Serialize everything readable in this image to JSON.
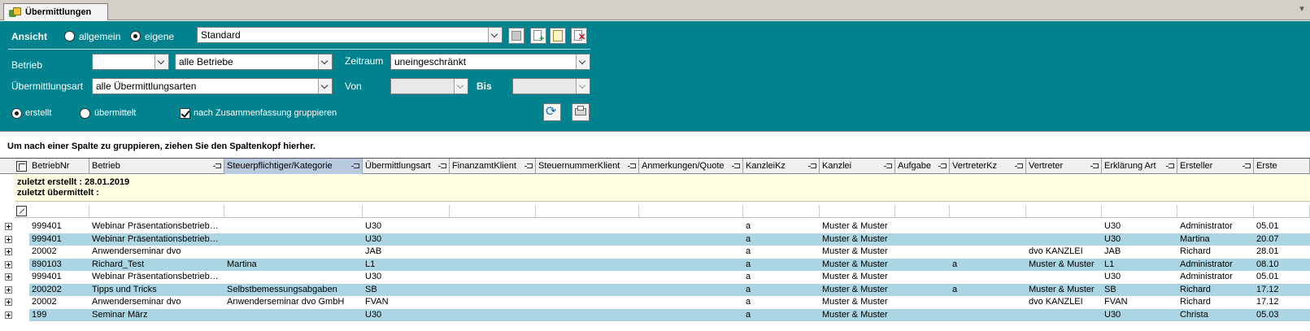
{
  "tab": {
    "title": "Übermittlungen",
    "icon": "transmission-icon"
  },
  "ansicht": {
    "label": "Ansicht",
    "option_allgemein": "allgemein",
    "option_eigene": "eigene",
    "selected": "eigene",
    "view_value": "Standard"
  },
  "betrieb": {
    "label": "Betrieb",
    "code_value": "",
    "value": "alle Betriebe"
  },
  "zeitraum": {
    "label": "Zeitraum",
    "value": "uneingeschränkt"
  },
  "uebermittlungsart": {
    "label": "Übermittlungsart",
    "value": "alle Übermittlungsarten"
  },
  "von": {
    "label": "Von",
    "value": ""
  },
  "bis": {
    "label": "Bis",
    "value": ""
  },
  "status": {
    "option_erstellt": "erstellt",
    "option_uebermittelt": "übermittelt",
    "selected": "erstellt"
  },
  "gruppieren": {
    "label": "nach Zusammenfassung gruppieren",
    "checked": true
  },
  "group_hint": "Um nach einer Spalte zu gruppieren, ziehen Sie den Spaltenkopf hierher.",
  "grid": {
    "columns": [
      "BetriebNr",
      "Betrieb",
      "Steuerpflichtiger/Kategorie",
      "Übermittlungsart",
      "FinanzamtKlient",
      "SteuernummerKlient",
      "Anmerkungen/Quote",
      "KanzleiKz",
      "Kanzlei",
      "Aufgabe",
      "VertreterKz",
      "Vertreter",
      "Erklärung Art",
      "Ersteller",
      "Erste"
    ],
    "selected_column": "Steuerpflichtiger/Kategorie",
    "summary_line1": "zuletzt erstellt : 28.01.2019",
    "summary_line2": "zuletzt übermittelt :",
    "rows": [
      [
        "999401",
        "Webinar  Präsentationsbetrieb…",
        "",
        "U30",
        "",
        "",
        "",
        "a",
        "Muster & Muster",
        "",
        "",
        "",
        "U30",
        "Administrator",
        "05.01"
      ],
      [
        "999401",
        "Webinar  Präsentationsbetrieb…",
        "",
        "U30",
        "",
        "",
        "",
        "a",
        "Muster & Muster",
        "",
        "",
        "",
        "U30",
        "Martina",
        "20.07"
      ],
      [
        "20002",
        "Anwenderseminar dvo",
        "",
        "JAB",
        "",
        "",
        "",
        "a",
        "Muster & Muster",
        "",
        "",
        "dvo KANZLEI",
        "JAB",
        "Richard",
        "28.01"
      ],
      [
        "890103",
        "Richard_Test",
        "Martina",
        "L1",
        "",
        "",
        "",
        "a",
        "Muster & Muster",
        "",
        "a",
        "Muster & Muster",
        "L1",
        "Administrator",
        "08.10"
      ],
      [
        "999401",
        "Webinar  Präsentationsbetrieb…",
        "",
        "U30",
        "",
        "",
        "",
        "a",
        "Muster & Muster",
        "",
        "",
        "",
        "U30",
        "Administrator",
        "05.01"
      ],
      [
        "200202",
        "Tipps und Tricks",
        "Selbstbemessungsabgaben",
        "SB",
        "",
        "",
        "",
        "a",
        "Muster & Muster",
        "",
        "a",
        "Muster & Muster",
        "SB",
        "Richard",
        "17.12"
      ],
      [
        "20002",
        "Anwenderseminar dvo",
        "Anwenderseminar dvo GmbH",
        "FVAN",
        "",
        "",
        "",
        "a",
        "Muster & Muster",
        "",
        "",
        "dvo KANZLEI",
        "FVAN",
        "Richard",
        "17.12"
      ],
      [
        "199",
        "Seminar März",
        "",
        "U30",
        "",
        "",
        "",
        "a",
        "Muster & Muster",
        "",
        "",
        "",
        "U30",
        "Christa",
        "05.03"
      ]
    ]
  },
  "colors": {
    "panel": "#00838f",
    "row_alt": "#abd5e2",
    "summary": "#ffffe1"
  }
}
